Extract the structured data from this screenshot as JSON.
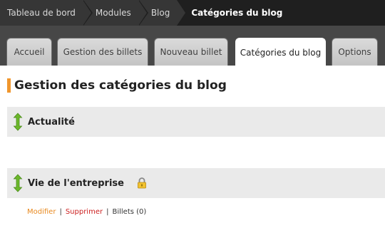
{
  "breadcrumb": {
    "items": [
      {
        "label": "Tableau de bord"
      },
      {
        "label": "Modules"
      },
      {
        "label": "Blog"
      }
    ],
    "current": "Catégories du blog"
  },
  "tabs": [
    {
      "label": "Accueil",
      "active": false
    },
    {
      "label": "Gestion des billets",
      "active": false
    },
    {
      "label": "Nouveau billet",
      "active": false
    },
    {
      "label": "Catégories du blog",
      "active": true
    },
    {
      "label": "Options",
      "active": false
    }
  ],
  "page": {
    "title": "Gestion des catégories du blog"
  },
  "categories": [
    {
      "name": "Actualité"
    },
    {
      "name": "Vie de l'entreprise",
      "locked": true,
      "actions": {
        "edit": "Modifier",
        "delete": "Supprimer",
        "posts": "Billets (0)"
      }
    }
  ],
  "colors": {
    "accent": "#f0962d",
    "handle": "#6cb82a",
    "delete": "#cc1f1f",
    "edit": "#e8891f"
  },
  "icons": {
    "drag": "drag-vertical-arrows-icon",
    "lock": "padlock-icon"
  }
}
